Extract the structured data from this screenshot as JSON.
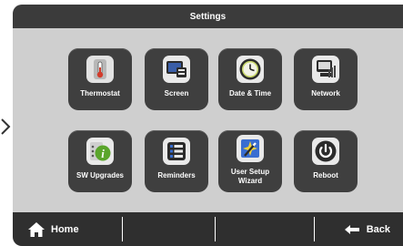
{
  "window": {
    "title": "Settings"
  },
  "tiles": [
    {
      "label": "Thermostat",
      "icon": "thermometer-icon"
    },
    {
      "label": "Screen",
      "icon": "screen-icon"
    },
    {
      "label": "Date & Time",
      "icon": "clock-icon"
    },
    {
      "label": "Network",
      "icon": "network-icon"
    },
    {
      "label": "SW Upgrades",
      "icon": "info-icon"
    },
    {
      "label": "Reminders",
      "icon": "list-icon"
    },
    {
      "label": "User Setup Wizard",
      "icon": "wizard-icon"
    },
    {
      "label": "Reboot",
      "icon": "power-icon"
    }
  ],
  "bottom": {
    "home_label": "Home",
    "back_label": "Back"
  },
  "colors": {
    "accent_green": "#5aa52b",
    "tile_bg": "#3f3f3f",
    "screen_bg": "#cfcfcf",
    "bar_bg": "#2f2f2f"
  }
}
